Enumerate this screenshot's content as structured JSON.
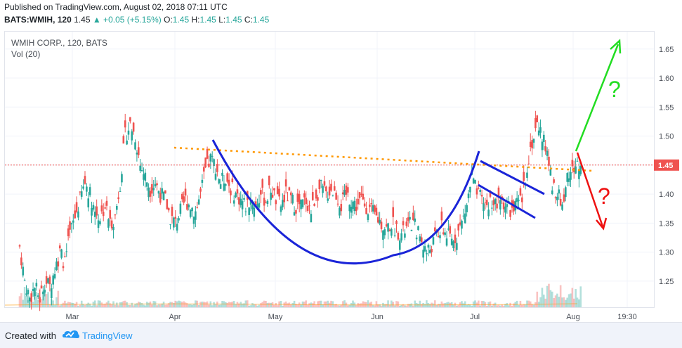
{
  "header": {
    "published": "Published on TradingView.com, August 02, 2018 07:11 UTC",
    "symbol": "BATS:WMIH, 120",
    "last": "1.45",
    "change": "▲ +0.05 (+5.15%)",
    "o_label": "O:",
    "o_value": "1.45",
    "h_label": "H:",
    "h_value": "1.45",
    "l_label": "L:",
    "l_value": "1.45",
    "c_label": "C:",
    "c_value": "1.45"
  },
  "legend": {
    "title": "WMIH CORP., 120, BATS",
    "volume": "Vol (20)"
  },
  "price_tag": "1.45",
  "annotations": {
    "up_question": "?",
    "down_question": "?"
  },
  "footer": {
    "created_with": "Created with",
    "brand": "TradingView"
  },
  "colors": {
    "up": "#26a69a",
    "down": "#ef5350",
    "blue": "#1a24d8",
    "orange": "#ff9800",
    "green": "#22dd22",
    "red": "#ee1111"
  },
  "chart_data": {
    "type": "candlestick",
    "y_ticks": [
      "1.25",
      "1.30",
      "1.35",
      "1.40",
      "1.45",
      "1.50",
      "1.55",
      "1.60",
      "1.65"
    ],
    "ylim": [
      1.205,
      1.68
    ],
    "x_ticks": [
      "Mar",
      "Apr",
      "May",
      "Jun",
      "Jul",
      "Aug",
      "19:30"
    ],
    "close_series": [
      1.31,
      1.25,
      1.22,
      1.24,
      1.22,
      1.25,
      1.24,
      1.27,
      1.3,
      1.28,
      1.33,
      1.36,
      1.39,
      1.42,
      1.4,
      1.37,
      1.36,
      1.38,
      1.35,
      1.36,
      1.42,
      1.5,
      1.52,
      1.5,
      1.45,
      1.43,
      1.41,
      1.42,
      1.4,
      1.39,
      1.36,
      1.35,
      1.37,
      1.39,
      1.38,
      1.37,
      1.4,
      1.44,
      1.46,
      1.45,
      1.42,
      1.43,
      1.41,
      1.4,
      1.39,
      1.38,
      1.39,
      1.38,
      1.4,
      1.39,
      1.41,
      1.39,
      1.38,
      1.4,
      1.39,
      1.38,
      1.38,
      1.39,
      1.37,
      1.4,
      1.41,
      1.4,
      1.41,
      1.4,
      1.38,
      1.4,
      1.39,
      1.38,
      1.39,
      1.38,
      1.37,
      1.36,
      1.35,
      1.34,
      1.35,
      1.34,
      1.33,
      1.34,
      1.35,
      1.34,
      1.32,
      1.3,
      1.31,
      1.33,
      1.34,
      1.33,
      1.32,
      1.33,
      1.35,
      1.38,
      1.43,
      1.4,
      1.39,
      1.38,
      1.39,
      1.38,
      1.39,
      1.38,
      1.37,
      1.38,
      1.39,
      1.45,
      1.49,
      1.52,
      1.5,
      1.47,
      1.42,
      1.4,
      1.38,
      1.43,
      1.44,
      1.45
    ],
    "trendline_resistance": [
      1.48,
      1.44
    ],
    "last_price": 1.45
  }
}
